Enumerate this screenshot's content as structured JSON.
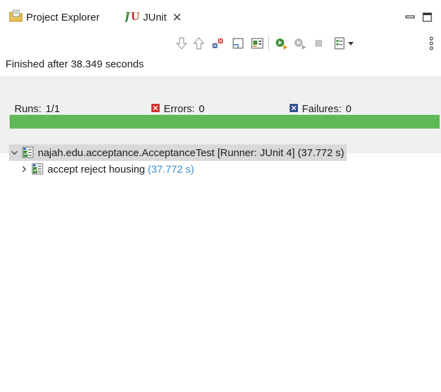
{
  "tabs": [
    {
      "label": "Project Explorer",
      "icon": "project-explorer-icon"
    },
    {
      "label": "JUnit",
      "icon": "junit-icon",
      "active": true
    }
  ],
  "view_menu": {
    "minimize_icon": "minimize-icon",
    "maximize_icon": "maximize-icon"
  },
  "toolbar_icons": [
    "next-failure-icon",
    "previous-failure-icon",
    "show-failures-only-icon",
    "scroll-lock-icon",
    "show-skipped-only-icon",
    "rerun-test-icon",
    "rerun-failed-first-icon",
    "stop-icon",
    "test-run-history-icon",
    "view-menu-chevron-icon",
    "view-menu-more-icon"
  ],
  "status": {
    "text": "Finished after 38.349 seconds"
  },
  "counters": {
    "runs_label": "Runs:",
    "runs_value": "1/1",
    "errors_label": "Errors:",
    "errors_value": "0",
    "failures_label": "Failures:",
    "failures_value": "0"
  },
  "progress": {
    "fraction": 1.0,
    "color": "#5fb956"
  },
  "colors": {
    "error": "#d32f2f",
    "failure": "#2f4f8f",
    "time": "#3d8ec9",
    "selected_row": "#d9d9d9"
  },
  "tree": [
    {
      "label": "najah.edu.acceptance.AcceptanceTest [Runner: JUnit 4] (37.772 s)",
      "expanded": true,
      "selected": true
    },
    {
      "label": "accept reject housing",
      "time": "(37.772 s)",
      "expanded": false
    }
  ]
}
